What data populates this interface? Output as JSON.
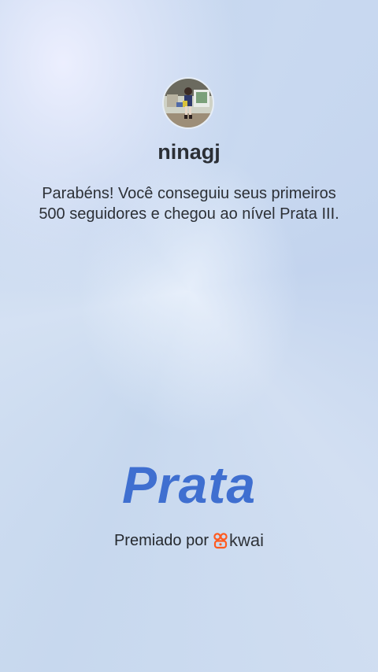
{
  "profile": {
    "username": "ninagj",
    "avatar_icon": "user-avatar-photo"
  },
  "message": {
    "text": "Parabéns! Você conseguiu seus primeiros 500 seguidores e chegou ao nível Prata III."
  },
  "level": {
    "name": "Prata"
  },
  "awarded": {
    "label": "Premiado por",
    "brand": "kwai",
    "brand_icon": "kwai-logo-icon",
    "brand_color": "#ff5a1f"
  },
  "colors": {
    "level_text": "#3f6fd0",
    "background": "#c9d9f0"
  }
}
